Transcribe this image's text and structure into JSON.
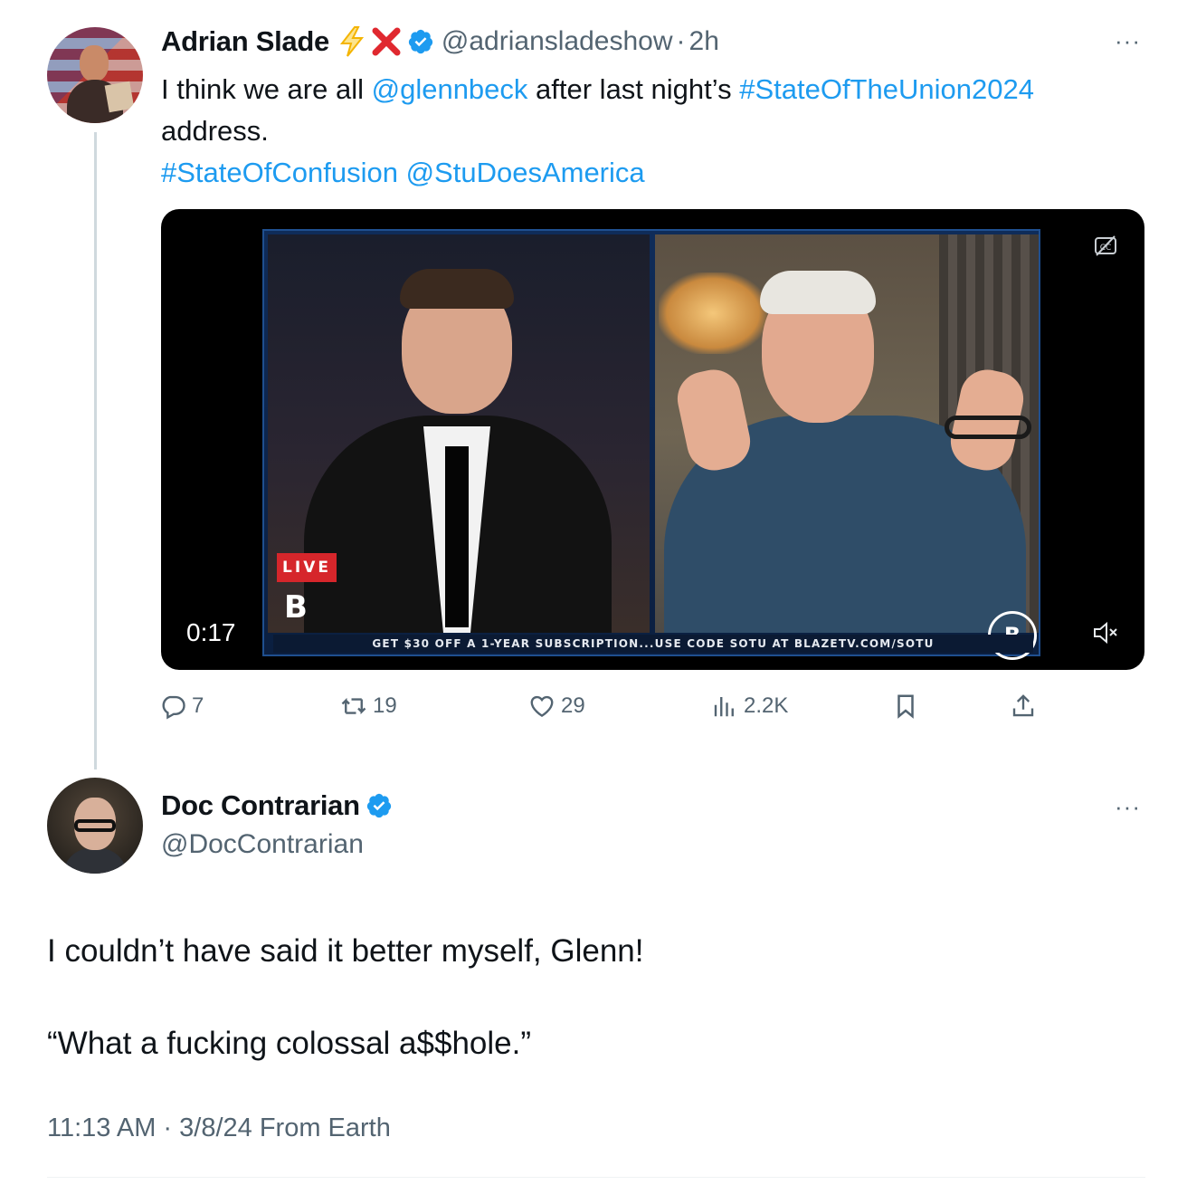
{
  "tweet1": {
    "author_name": "Adrian Slade",
    "emoji_bolt": "⚡",
    "emoji_cross": "❌",
    "handle": "@adriansladeshow",
    "separator": "·",
    "time": "2h",
    "text_parts": {
      "t1": "I think we are all ",
      "mention1": "@glennbeck",
      "t2": " after last night’s ",
      "hashtag1": "#StateOfTheUnion2024",
      "t3": " address.",
      "hashtag2": "#StateOfConfusion",
      "mention2": "@StuDoesAmerica"
    },
    "video": {
      "duration": "0:17",
      "live_label": "LIVE",
      "logo_letter": "B",
      "ticker": "GET $30 OFF A 1-YEAR SUBSCRIPTION...USE CODE SOTU AT BLAZETV.COM/SOTU"
    },
    "actions": {
      "replies": "7",
      "reposts": "19",
      "likes": "29",
      "views": "2.2K"
    }
  },
  "tweet2": {
    "author_name": "Doc Contrarian",
    "handle": "@DocContrarian",
    "body_line1": "I couldn’t have said it better myself, Glenn!",
    "body_line2": "“What a fucking colossal a$$hole.”",
    "meta": "11:13 AM · 3/8/24 From Earth"
  },
  "more_label": "···",
  "colors": {
    "link": "#1d9bf0",
    "secondary_text": "#536471",
    "primary_text": "#0f1419",
    "thread_line": "#cfd9de",
    "live_red": "#d6262b"
  }
}
